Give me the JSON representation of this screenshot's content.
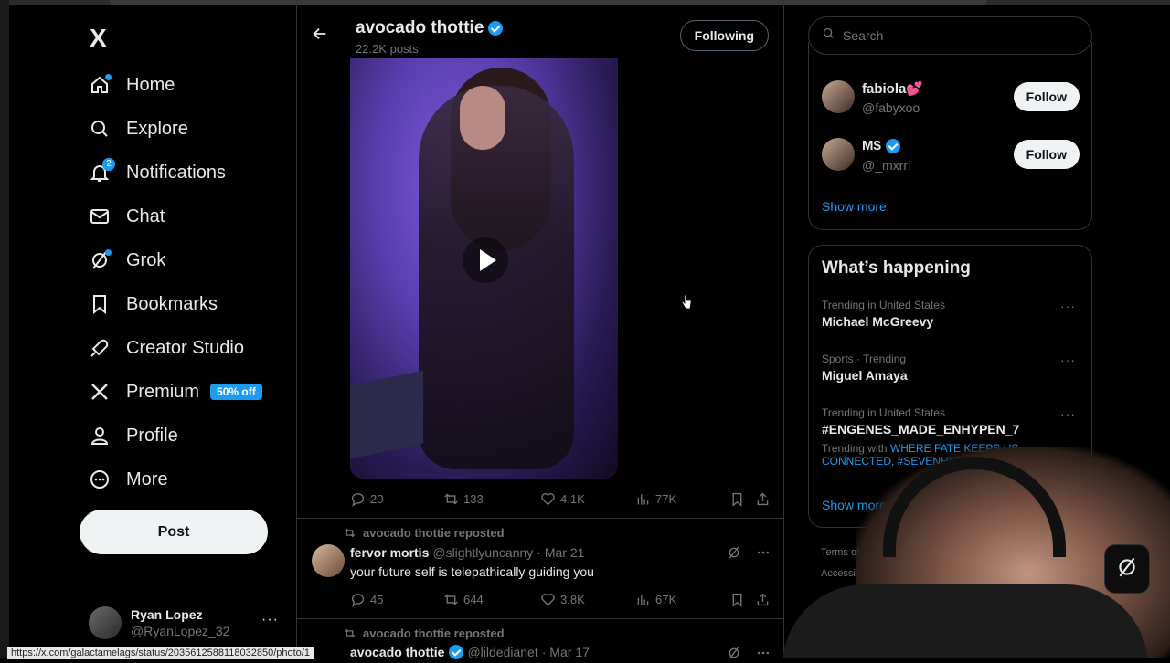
{
  "nav": {
    "logo": "X",
    "items": [
      {
        "label": "Home",
        "icon": "home-icon",
        "dot": true
      },
      {
        "label": "Explore",
        "icon": "search-icon"
      },
      {
        "label": "Notifications",
        "icon": "bell-icon",
        "badge": "2"
      },
      {
        "label": "Chat",
        "icon": "mail-icon"
      },
      {
        "label": "Grok",
        "icon": "grok-icon",
        "dot": true
      },
      {
        "label": "Bookmarks",
        "icon": "bookmark-icon"
      },
      {
        "label": "Creator Studio",
        "icon": "rocket-icon"
      },
      {
        "label": "Premium",
        "icon": "x-logo-icon",
        "badge_text": "50% off"
      },
      {
        "label": "Profile",
        "icon": "person-icon"
      },
      {
        "label": "More",
        "icon": "more-circle-icon"
      }
    ],
    "post_label": "Post",
    "account": {
      "name": "Ryan Lopez",
      "handle": "@RyanLopez_32",
      "more": "···"
    }
  },
  "header": {
    "title": "avocado thottie",
    "subtitle": "22.2K posts",
    "following_label": "Following"
  },
  "first_post": {
    "stats": {
      "replies": "20",
      "reposts": "133",
      "likes": "4.1K",
      "views": "77K"
    }
  },
  "tweets": [
    {
      "repost_label": "avocado thottie reposted",
      "name": "fervor mortis",
      "handle": "@slightlyuncanny",
      "date": "· Mar 21",
      "text": "your future self is telepathically guiding you",
      "stats": {
        "replies": "45",
        "reposts": "644",
        "likes": "3.8K",
        "views": "67K"
      }
    },
    {
      "repost_label": "avocado thottie reposted",
      "name": "avocado thottie",
      "handle": "@lildedianet",
      "date": "· Mar 17"
    }
  ],
  "sidebar": {
    "search_placeholder": "Search",
    "who_to_follow": [
      {
        "name": "fabiola💕",
        "handle": "@fabyxoo",
        "follow_label": "Follow",
        "verified": false
      },
      {
        "name": "M$",
        "handle": "@_mxrrl",
        "follow_label": "Follow",
        "verified": true
      }
    ],
    "show_more_1": "Show more",
    "happening_title": "What’s happening",
    "trends": [
      {
        "meta": "Trending in United States",
        "name": "Michael McGreevy"
      },
      {
        "meta": "Sports · Trending",
        "name": "Miguel Amaya"
      },
      {
        "meta": "Trending in United States",
        "name": "#ENGENES_MADE_ENHYPEN_7",
        "trending_with_label": "Trending with",
        "trending_with": "WHERE FATE KEEPS US CONNECTED, #SEVENHYPEN"
      }
    ],
    "show_more_2": "Show more",
    "footer": {
      "line1": "Terms of Servic",
      "line2": "Accessibility"
    }
  },
  "status_url": "https://x.com/galactamelags/status/2035612588118032850/photo/1",
  "colors": {
    "accent": "#1d9bf0",
    "bg": "#000000",
    "border": "#2f3336",
    "muted": "#71767b"
  }
}
